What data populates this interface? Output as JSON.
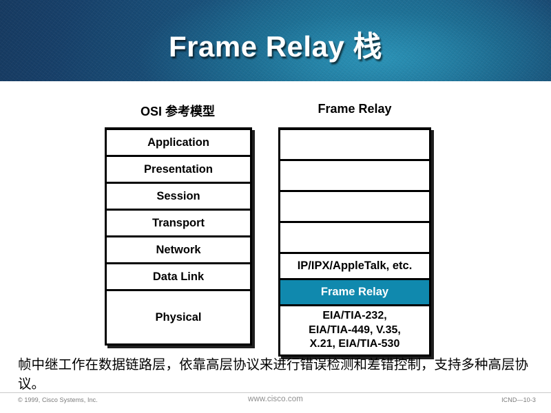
{
  "slide": {
    "title": "Frame Relay 栈",
    "columns": {
      "osi_heading": "OSI 参考模型",
      "frame_relay_heading": "Frame  Relay"
    },
    "osi_layers": [
      "Application",
      "Presentation",
      "Session",
      "Transport",
      "Network",
      "Data Link",
      "Physical"
    ],
    "frame_relay_cells": [
      "",
      "",
      "",
      "",
      "IP/IPX/AppleTalk, etc.",
      "Frame Relay",
      "EIA/TIA-232,\nEIA/TIA-449, V.35,\nX.21, EIA/TIA-530"
    ],
    "frame_relay_lines": {
      "network": "IP/IPX/AppleTalk, etc.",
      "data_link": "Frame Relay",
      "physical_line1": "EIA/TIA-232,",
      "physical_line2": "EIA/TIA-449, V.35,",
      "physical_line3": "X.21, EIA/TIA-530"
    },
    "body_text": "帧中继工作在数据链路层，依靠高层协议来进行错误检测和差错控制，支持多种高层协议。",
    "footer": {
      "copyright": "© 1999, Cisco Systems, Inc.",
      "url": "www.cisco.com",
      "code": "ICND—10-3"
    },
    "colors": {
      "highlight": "#1089ae",
      "banner_dark": "#16375c",
      "banner_light": "#1f749c",
      "title_text": "#ffffff",
      "footer_text": "#7a7a7a"
    }
  }
}
